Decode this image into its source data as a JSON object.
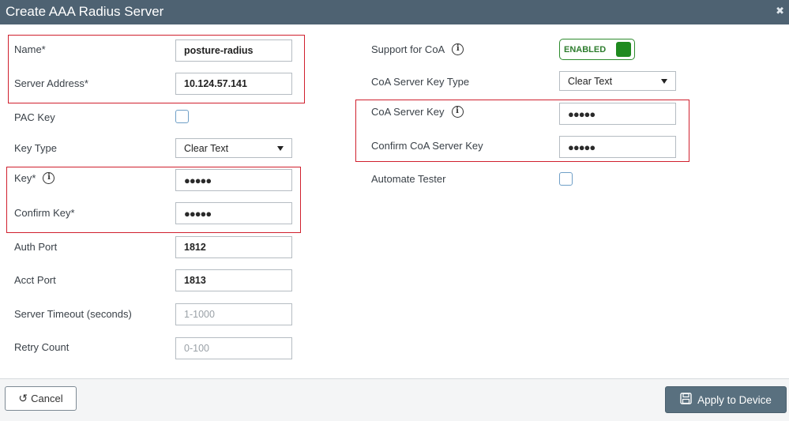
{
  "window": {
    "title": "Create AAA Radius Server",
    "close_icon": "✖"
  },
  "left": {
    "name": {
      "label": "Name*",
      "value": "posture-radius"
    },
    "server_address": {
      "label": "Server Address*",
      "value": "10.124.57.141"
    },
    "pac_key": {
      "label": "PAC Key",
      "checked": false
    },
    "key_type": {
      "label": "Key Type",
      "selected": "Clear Text"
    },
    "key": {
      "label": "Key*",
      "value": "●●●●●"
    },
    "confirm_key": {
      "label": "Confirm Key*",
      "value": "●●●●●"
    },
    "auth_port": {
      "label": "Auth Port",
      "value": "1812"
    },
    "acct_port": {
      "label": "Acct Port",
      "value": "1813"
    },
    "server_timeout": {
      "label": "Server Timeout (seconds)",
      "placeholder": "1-1000"
    },
    "retry_count": {
      "label": "Retry Count",
      "placeholder": "0-100"
    }
  },
  "right": {
    "support_coa": {
      "label": "Support for CoA",
      "state": "ENABLED"
    },
    "coa_key_type": {
      "label": "CoA Server Key Type",
      "selected": "Clear Text"
    },
    "coa_key": {
      "label": "CoA Server Key",
      "value": "●●●●●"
    },
    "confirm_coa_key": {
      "label": "Confirm CoA Server Key",
      "value": "●●●●●"
    },
    "automate_tester": {
      "label": "Automate Tester",
      "checked": false
    }
  },
  "footer": {
    "cancel_label": "Cancel",
    "cancel_icon": "↺",
    "apply_label": "Apply to Device"
  },
  "colors": {
    "titlebar": "#4e6272",
    "highlight": "#d0202e",
    "toggle_on": "#1f8a1f",
    "apply_button": "#59707f"
  },
  "icons": {
    "info": "info-icon",
    "save": "floppy-disk-icon",
    "undo": "undo-icon",
    "close": "close-icon"
  }
}
